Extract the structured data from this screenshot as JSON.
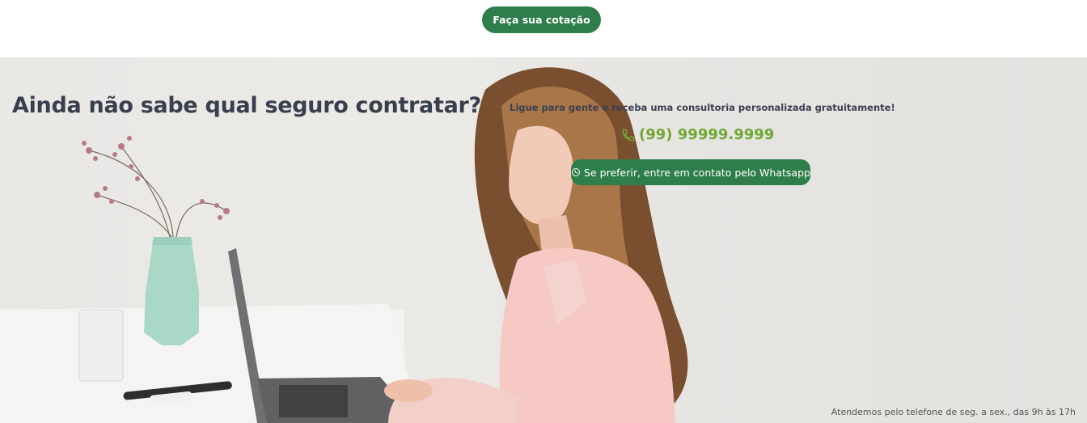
{
  "header": {
    "quote_button": "Faça sua cotação"
  },
  "hero": {
    "headline": "Ainda não sabe qual seguro contratar?",
    "consult_text": "Ligue para gente e receba uma consultoria personalizada gratuitamente!",
    "phone": "(99) 99999.9999",
    "whatsapp_button": "Se preferir, entre em contato pelo Whatsapp",
    "hours": "Atendemos pelo telefone de seg. a sex., das 9h às 17h"
  },
  "colors": {
    "brand_green": "#2e7d4a",
    "phone_green": "#6fa832",
    "headline": "#3a3f4d"
  },
  "icons": {
    "phone": "phone-icon",
    "whatsapp": "whatsapp-icon"
  }
}
